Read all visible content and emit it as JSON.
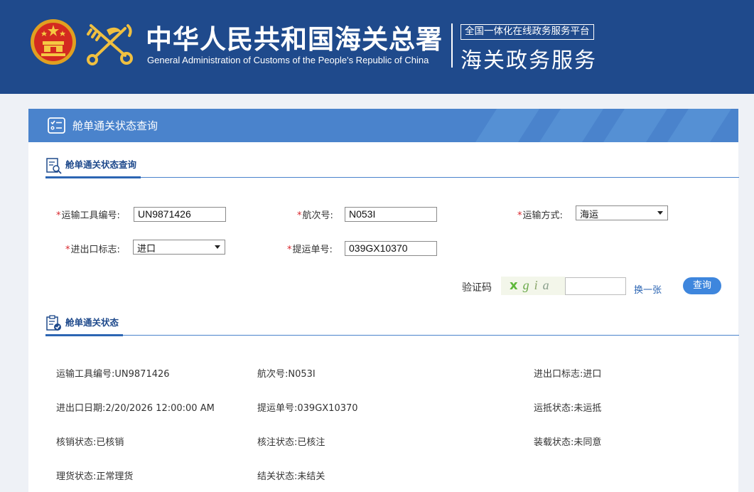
{
  "header": {
    "title_cn": "中华人民共和国海关总署",
    "title_en": "General Administration of Customs of the People's Republic of China",
    "platform_label": "全国一体化在线政务服务平台",
    "service_title": "海关政务服务"
  },
  "panel": {
    "title": "舱单通关状态查询"
  },
  "query_section": {
    "title": "舱单通关状态查询",
    "fields": {
      "vehicle_no": {
        "label": "运输工具编号:",
        "value": "UN9871426"
      },
      "voyage_no": {
        "label": "航次号:",
        "value": "N053I"
      },
      "transport_mode": {
        "label": "运输方式:",
        "value": "海运"
      },
      "ie_flag": {
        "label": "进出口标志:",
        "value": "进口"
      },
      "bill_no": {
        "label": "提运单号:",
        "value": "039GX10370"
      }
    },
    "required_mark": "*",
    "captcha": {
      "label": "验证码",
      "chars": [
        "x",
        "g",
        "i",
        "a"
      ],
      "char_colors": [
        "#5fb83a",
        "#6aa94b",
        "#8aa56a",
        "#8a9f8c"
      ],
      "input_value": "",
      "refresh_label": "换一张"
    },
    "query_button": "查询"
  },
  "status_section": {
    "title": "舱单通关状态",
    "rows": [
      [
        {
          "label": "运输工具编号:",
          "value": "UN9871426"
        },
        {
          "label": "航次号:",
          "value": "N053I"
        },
        {
          "label": "进出口标志:",
          "value": "进口"
        }
      ],
      [
        {
          "label": "进出口日期:",
          "value": "2/20/2026 12:00:00 AM"
        },
        {
          "label": "提运单号:",
          "value": "039GX10370"
        },
        {
          "label": "运抵状态:",
          "value": "未运抵"
        }
      ],
      [
        {
          "label": "核销状态:",
          "value": "已核销"
        },
        {
          "label": "核注状态:",
          "value": "已核注"
        },
        {
          "label": "装载状态:",
          "value": "未同意"
        }
      ],
      [
        {
          "label": "理货状态:",
          "value": "正常理货"
        },
        {
          "label": "结关状态:",
          "value": "未结关"
        }
      ]
    ]
  },
  "colors": {
    "header_bg": "#1f4a8c",
    "panel_header_bg": "#4a83cc",
    "accent": "#2c65b3",
    "required": "#d9262c",
    "button": "#3e86dd"
  }
}
